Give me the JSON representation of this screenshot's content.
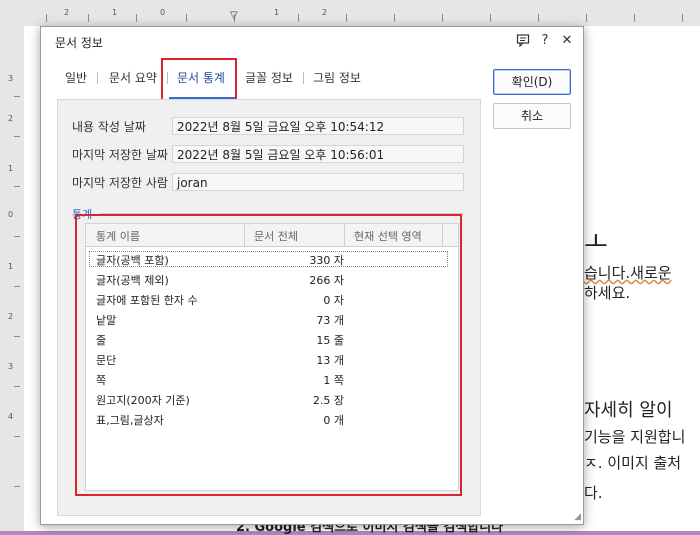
{
  "background": {
    "ruler_top_numbers": [
      "2",
      "1",
      "0",
      "1",
      "2"
    ],
    "ruler_left_numbers": [
      "3",
      "2",
      "1",
      "0",
      "1",
      "2",
      "3",
      "4"
    ],
    "doc_lines": [
      "ㅗ",
      "습니다.새로운",
      "하세요.",
      "자세히 알이",
      "기능을 지원합니",
      "ㅈ. 이미지 출처",
      "다.",
      "2.  Google  검색으로  이미지  검색을  검색합니다"
    ]
  },
  "dialog": {
    "title": "문서 정보",
    "icons": {
      "comment": "comment-icon",
      "help": "?",
      "close": "✕"
    },
    "tabs": [
      {
        "label": "일반"
      },
      {
        "label": "문서 요약"
      },
      {
        "label": "문서 통계"
      },
      {
        "label": "글꼴 정보"
      },
      {
        "label": "그림 정보"
      }
    ],
    "active_tab": "문서 통계",
    "fields": {
      "created_label": "내용 작성 날짜",
      "created_value": "2022년 8월 5일 금요일 오후 10:54:12",
      "saved_label": "마지막 저장한 날짜",
      "saved_value": "2022년 8월 5일 금요일 오후 10:56:01",
      "saver_label": "마지막 저장한 사람",
      "saver_value": "joran"
    },
    "stats": {
      "group_label": "통계",
      "columns": [
        "통계 이름",
        "문서 전체",
        "현재 선택 영역"
      ],
      "rows": [
        {
          "name": "글자(공백 포함)",
          "value": "330 자"
        },
        {
          "name": "글자(공백 제외)",
          "value": "266 자"
        },
        {
          "name": "글자에 포함된 한자 수",
          "value": "0 자"
        },
        {
          "name": "낱말",
          "value": "73 개"
        },
        {
          "name": "줄",
          "value": "15 줄"
        },
        {
          "name": "문단",
          "value": "13 개"
        },
        {
          "name": "쪽",
          "value": "1 쪽"
        },
        {
          "name": "원고지(200자 기준)",
          "value": "2.5 장"
        },
        {
          "name": "표,그림,글상자",
          "value": "0 개"
        }
      ]
    },
    "buttons": {
      "ok": "확인(D)",
      "cancel": "취소"
    },
    "colors": {
      "highlight": "#d9262c",
      "accent": "#3a6cc8",
      "backdrop": "#b785c0"
    }
  }
}
